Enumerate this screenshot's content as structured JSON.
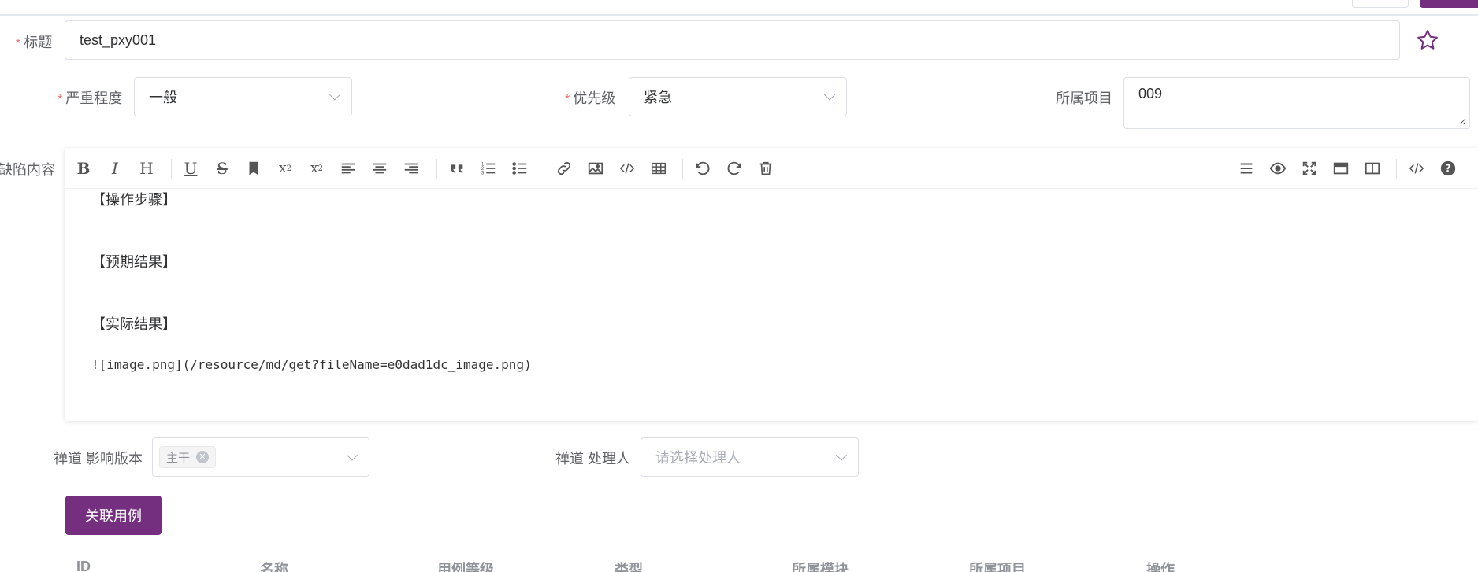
{
  "form": {
    "title_label": "标题",
    "title_value": "test_pxy001",
    "severity_label": "严重程度",
    "severity_value": "一般",
    "priority_label": "优先级",
    "priority_value": "紧急",
    "project_label": "所属项目",
    "project_value": "009",
    "content_label": "缺陷内容",
    "version_label": "禅道 影响版本",
    "version_tag": "主干",
    "handler_label": "禅道 处理人",
    "handler_placeholder": "请选择处理人",
    "required_mark": "*"
  },
  "editor": {
    "toolbar_left": [
      "bold-icon",
      "italic-icon",
      "heading-icon",
      "underline-icon",
      "strikethrough-icon",
      "bookmark-icon",
      "superscript-icon",
      "subscript-icon",
      "align-left-icon",
      "align-center-icon",
      "align-right-icon",
      "quote-icon",
      "ordered-list-icon",
      "unordered-list-icon",
      "link-icon",
      "image-icon",
      "code-icon",
      "table-icon",
      "undo-icon",
      "redo-icon",
      "trash-icon"
    ],
    "toolbar_right": [
      "menu-icon",
      "preview-icon",
      "fullscreen-icon",
      "window-icon",
      "split-view-icon",
      "html-code-icon",
      "help-icon"
    ],
    "lines": {
      "steps": "【操作步骤】",
      "expected": "【预期结果】",
      "actual": "【实际结果】",
      "image": "![image.png](/resource/md/get?fileName=e0dad1dc_image.png)"
    }
  },
  "actions": {
    "link_case_button": "关联用例"
  },
  "table": {
    "headers": [
      "ID",
      "名称",
      "用例等级",
      "类型",
      "所属模块",
      "所属项目",
      "操作"
    ]
  },
  "colors": {
    "primary": "#74307f",
    "required": "#f56c6c",
    "border": "#dcdfe6"
  }
}
